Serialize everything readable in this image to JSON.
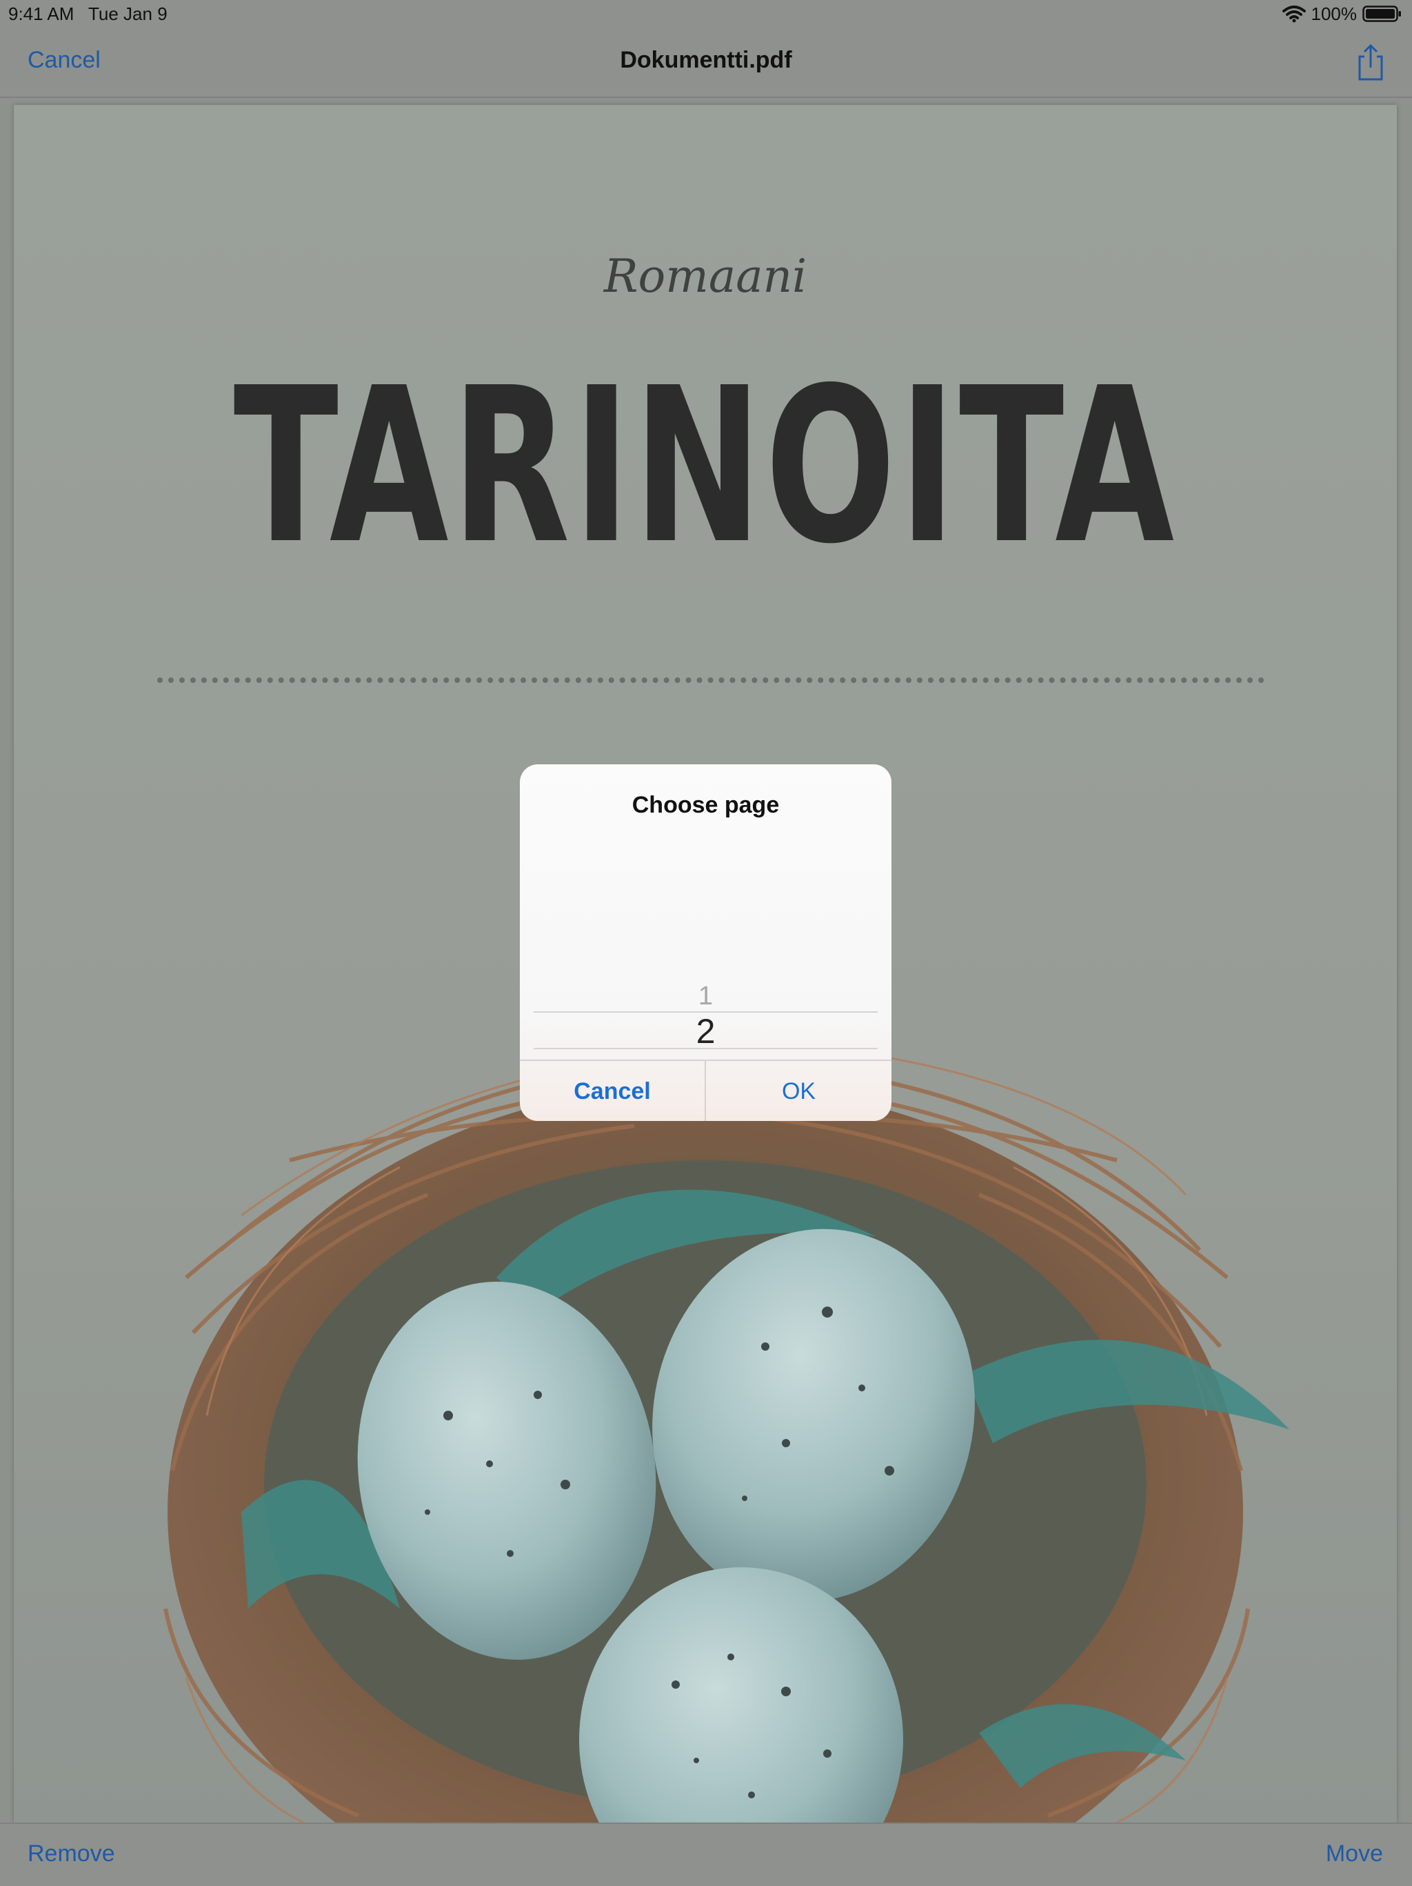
{
  "status_bar": {
    "time": "9:41 AM",
    "date": "Tue Jan 9",
    "battery": "100%",
    "icons": [
      "wifi-icon",
      "battery-icon"
    ]
  },
  "nav": {
    "cancel_label": "Cancel",
    "title": "Dokumentti.pdf",
    "share_icon": "share-icon"
  },
  "document": {
    "subtitle": "Romaani",
    "title": "TARINOITA",
    "cover_image": "bird-nest-with-eggs"
  },
  "dialog": {
    "title": "Choose page",
    "picker_options": [
      "1",
      "2"
    ],
    "selected_value": "2",
    "cancel_label": "Cancel",
    "ok_label": "OK"
  },
  "toolbar": {
    "remove_label": "Remove",
    "move_label": "Move"
  },
  "colors": {
    "accent_link": "#1a6fd6",
    "dimmed_link": "#1f5aa5",
    "title_text": "#2b2c2b"
  }
}
